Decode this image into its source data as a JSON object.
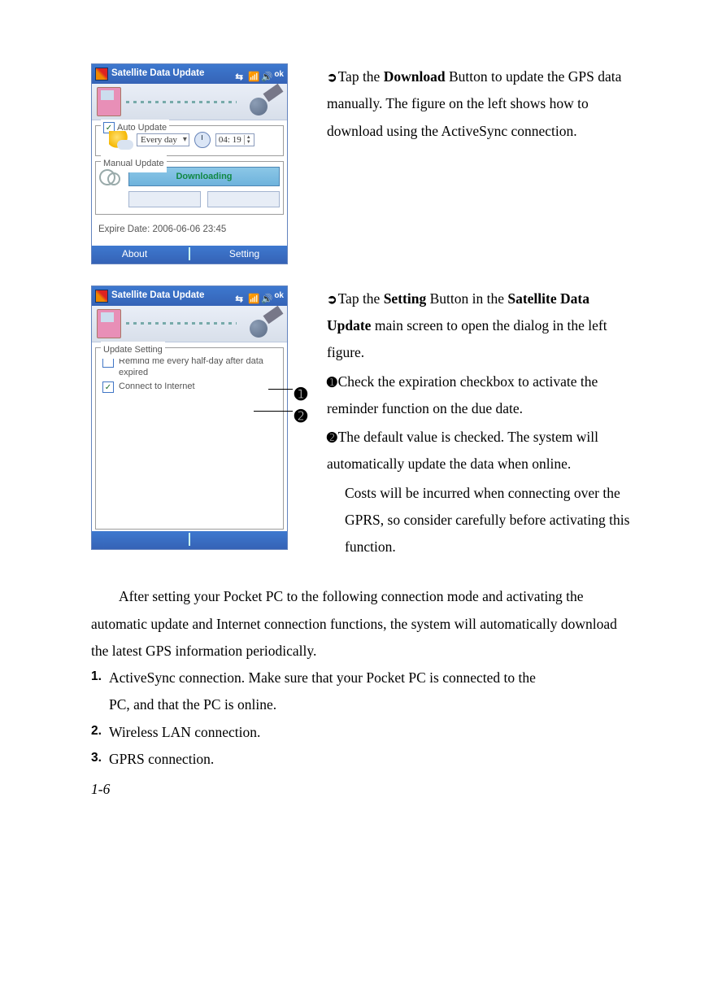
{
  "pda_top": {
    "title": "Satellite Data Update",
    "ok": "ok",
    "auto_group": "Auto Update",
    "freq": "Every day",
    "time": "04: 19",
    "manual_group": "Manual Update",
    "download_btn": "Downloading",
    "expire": "Expire Date: 2006-06-06 23:45",
    "tab_about": "About",
    "tab_setting": "Setting"
  },
  "pda_bottom": {
    "title": "Satellite Data Update",
    "ok": "ok",
    "group": "Update Setting",
    "opt1": "Remind me every half-day after data expired",
    "opt2": "Connect to Internet"
  },
  "right1": {
    "bullet": "➲",
    "t1a": "Tap the ",
    "b1": "Download",
    "t1b": " Button to update the GPS data manually. The figure on the left shows how to download using the ActiveSync connection."
  },
  "right2": {
    "bullet": "➲",
    "r1a": "Tap the ",
    "b1": "Setting",
    "r1b": " Button in the ",
    "b2": "Satellite Data Update",
    "r1c": " main screen to open the dialog in the left figure.",
    "n1": "➊",
    "s1": "Check the expiration checkbox to activate the reminder function on the due date.",
    "n2": "➋",
    "s2a": "The default value is checked. The system will automatically update the data when online.",
    "s2b": "Costs will be incurred when connecting over the GPRS, so consider carefully before activating this function."
  },
  "body": {
    "p1": "After setting your Pocket PC to the following connection mode and activating the automatic update and Internet connection functions, the system will automatically download the latest GPS information periodically.",
    "li1a": "ActiveSync connection. Make sure that your Pocket PC is connected to the",
    "li1b": "PC, and that the PC is online.",
    "li2": "Wireless LAN connection.",
    "li3": "GPRS connection.",
    "n1": "1.",
    "n2": "2.",
    "n3": "3."
  },
  "page": "1-6",
  "ann": {
    "one": "➊",
    "two": "➋"
  }
}
